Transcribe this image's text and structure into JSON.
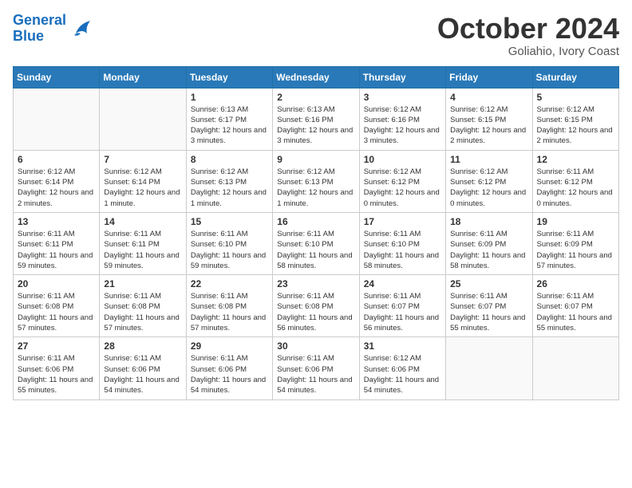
{
  "header": {
    "logo_line1": "General",
    "logo_line2": "Blue",
    "month": "October 2024",
    "location": "Goliahio, Ivory Coast"
  },
  "weekdays": [
    "Sunday",
    "Monday",
    "Tuesday",
    "Wednesday",
    "Thursday",
    "Friday",
    "Saturday"
  ],
  "weeks": [
    [
      {
        "day": "",
        "info": ""
      },
      {
        "day": "",
        "info": ""
      },
      {
        "day": "1",
        "info": "Sunrise: 6:13 AM\nSunset: 6:17 PM\nDaylight: 12 hours and 3 minutes."
      },
      {
        "day": "2",
        "info": "Sunrise: 6:13 AM\nSunset: 6:16 PM\nDaylight: 12 hours and 3 minutes."
      },
      {
        "day": "3",
        "info": "Sunrise: 6:12 AM\nSunset: 6:16 PM\nDaylight: 12 hours and 3 minutes."
      },
      {
        "day": "4",
        "info": "Sunrise: 6:12 AM\nSunset: 6:15 PM\nDaylight: 12 hours and 2 minutes."
      },
      {
        "day": "5",
        "info": "Sunrise: 6:12 AM\nSunset: 6:15 PM\nDaylight: 12 hours and 2 minutes."
      }
    ],
    [
      {
        "day": "6",
        "info": "Sunrise: 6:12 AM\nSunset: 6:14 PM\nDaylight: 12 hours and 2 minutes."
      },
      {
        "day": "7",
        "info": "Sunrise: 6:12 AM\nSunset: 6:14 PM\nDaylight: 12 hours and 1 minute."
      },
      {
        "day": "8",
        "info": "Sunrise: 6:12 AM\nSunset: 6:13 PM\nDaylight: 12 hours and 1 minute."
      },
      {
        "day": "9",
        "info": "Sunrise: 6:12 AM\nSunset: 6:13 PM\nDaylight: 12 hours and 1 minute."
      },
      {
        "day": "10",
        "info": "Sunrise: 6:12 AM\nSunset: 6:12 PM\nDaylight: 12 hours and 0 minutes."
      },
      {
        "day": "11",
        "info": "Sunrise: 6:12 AM\nSunset: 6:12 PM\nDaylight: 12 hours and 0 minutes."
      },
      {
        "day": "12",
        "info": "Sunrise: 6:11 AM\nSunset: 6:12 PM\nDaylight: 12 hours and 0 minutes."
      }
    ],
    [
      {
        "day": "13",
        "info": "Sunrise: 6:11 AM\nSunset: 6:11 PM\nDaylight: 11 hours and 59 minutes."
      },
      {
        "day": "14",
        "info": "Sunrise: 6:11 AM\nSunset: 6:11 PM\nDaylight: 11 hours and 59 minutes."
      },
      {
        "day": "15",
        "info": "Sunrise: 6:11 AM\nSunset: 6:10 PM\nDaylight: 11 hours and 59 minutes."
      },
      {
        "day": "16",
        "info": "Sunrise: 6:11 AM\nSunset: 6:10 PM\nDaylight: 11 hours and 58 minutes."
      },
      {
        "day": "17",
        "info": "Sunrise: 6:11 AM\nSunset: 6:10 PM\nDaylight: 11 hours and 58 minutes."
      },
      {
        "day": "18",
        "info": "Sunrise: 6:11 AM\nSunset: 6:09 PM\nDaylight: 11 hours and 58 minutes."
      },
      {
        "day": "19",
        "info": "Sunrise: 6:11 AM\nSunset: 6:09 PM\nDaylight: 11 hours and 57 minutes."
      }
    ],
    [
      {
        "day": "20",
        "info": "Sunrise: 6:11 AM\nSunset: 6:08 PM\nDaylight: 11 hours and 57 minutes."
      },
      {
        "day": "21",
        "info": "Sunrise: 6:11 AM\nSunset: 6:08 PM\nDaylight: 11 hours and 57 minutes."
      },
      {
        "day": "22",
        "info": "Sunrise: 6:11 AM\nSunset: 6:08 PM\nDaylight: 11 hours and 57 minutes."
      },
      {
        "day": "23",
        "info": "Sunrise: 6:11 AM\nSunset: 6:08 PM\nDaylight: 11 hours and 56 minutes."
      },
      {
        "day": "24",
        "info": "Sunrise: 6:11 AM\nSunset: 6:07 PM\nDaylight: 11 hours and 56 minutes."
      },
      {
        "day": "25",
        "info": "Sunrise: 6:11 AM\nSunset: 6:07 PM\nDaylight: 11 hours and 55 minutes."
      },
      {
        "day": "26",
        "info": "Sunrise: 6:11 AM\nSunset: 6:07 PM\nDaylight: 11 hours and 55 minutes."
      }
    ],
    [
      {
        "day": "27",
        "info": "Sunrise: 6:11 AM\nSunset: 6:06 PM\nDaylight: 11 hours and 55 minutes."
      },
      {
        "day": "28",
        "info": "Sunrise: 6:11 AM\nSunset: 6:06 PM\nDaylight: 11 hours and 54 minutes."
      },
      {
        "day": "29",
        "info": "Sunrise: 6:11 AM\nSunset: 6:06 PM\nDaylight: 11 hours and 54 minutes."
      },
      {
        "day": "30",
        "info": "Sunrise: 6:11 AM\nSunset: 6:06 PM\nDaylight: 11 hours and 54 minutes."
      },
      {
        "day": "31",
        "info": "Sunrise: 6:12 AM\nSunset: 6:06 PM\nDaylight: 11 hours and 54 minutes."
      },
      {
        "day": "",
        "info": ""
      },
      {
        "day": "",
        "info": ""
      }
    ]
  ]
}
